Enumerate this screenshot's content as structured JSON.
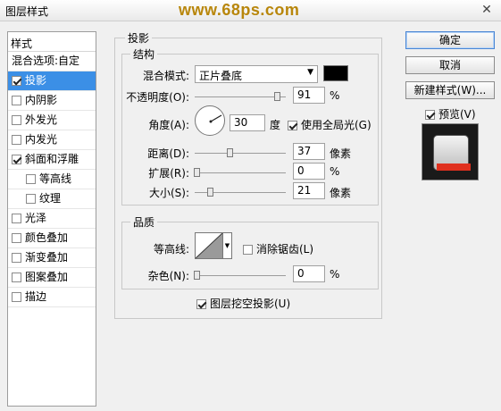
{
  "window": {
    "title": "图层样式",
    "watermark": "www.68ps.com",
    "close_icon": "close-icon"
  },
  "sidebar": {
    "header": "样式",
    "items": [
      {
        "label": "混合选项:自定",
        "checkbox": false,
        "checked": false,
        "selected": false,
        "sub": false
      },
      {
        "label": "投影",
        "checkbox": true,
        "checked": true,
        "selected": true,
        "sub": false
      },
      {
        "label": "内阴影",
        "checkbox": true,
        "checked": false,
        "selected": false,
        "sub": false
      },
      {
        "label": "外发光",
        "checkbox": true,
        "checked": false,
        "selected": false,
        "sub": false
      },
      {
        "label": "内发光",
        "checkbox": true,
        "checked": false,
        "selected": false,
        "sub": false
      },
      {
        "label": "斜面和浮雕",
        "checkbox": true,
        "checked": true,
        "selected": false,
        "sub": false
      },
      {
        "label": "等高线",
        "checkbox": true,
        "checked": false,
        "selected": false,
        "sub": true
      },
      {
        "label": "纹理",
        "checkbox": true,
        "checked": false,
        "selected": false,
        "sub": true
      },
      {
        "label": "光泽",
        "checkbox": true,
        "checked": false,
        "selected": false,
        "sub": false
      },
      {
        "label": "颜色叠加",
        "checkbox": true,
        "checked": false,
        "selected": false,
        "sub": false
      },
      {
        "label": "渐变叠加",
        "checkbox": true,
        "checked": false,
        "selected": false,
        "sub": false
      },
      {
        "label": "图案叠加",
        "checkbox": true,
        "checked": false,
        "selected": false,
        "sub": false
      },
      {
        "label": "描边",
        "checkbox": true,
        "checked": false,
        "selected": false,
        "sub": false
      }
    ]
  },
  "drop_shadow": {
    "section_title": "投影",
    "structure": {
      "title": "结构",
      "blend_mode_label": "混合模式:",
      "blend_mode_value": "正片叠底",
      "shadow_color": "#000000",
      "opacity_label": "不透明度(O):",
      "opacity_value": "91",
      "opacity_unit": "%",
      "angle_label": "角度(A):",
      "angle_value": "30",
      "angle_unit": "度",
      "global_light_label": "使用全局光(G)",
      "global_light_checked": true,
      "distance_label": "距离(D):",
      "distance_value": "37",
      "distance_unit": "像素",
      "spread_label": "扩展(R):",
      "spread_value": "0",
      "spread_unit": "%",
      "size_label": "大小(S):",
      "size_value": "21",
      "size_unit": "像素"
    },
    "quality": {
      "title": "品质",
      "contour_label": "等高线:",
      "anti_aliased_label": "消除锯齿(L)",
      "anti_aliased_checked": false,
      "noise_label": "杂色(N):",
      "noise_value": "0",
      "noise_unit": "%"
    },
    "knockout_label": "图层挖空投影(U)",
    "knockout_checked": true
  },
  "buttons": {
    "ok": "确定",
    "cancel": "取消",
    "new_style": "新建样式(W)...",
    "preview_label": "预览(V)",
    "preview_checked": true
  }
}
